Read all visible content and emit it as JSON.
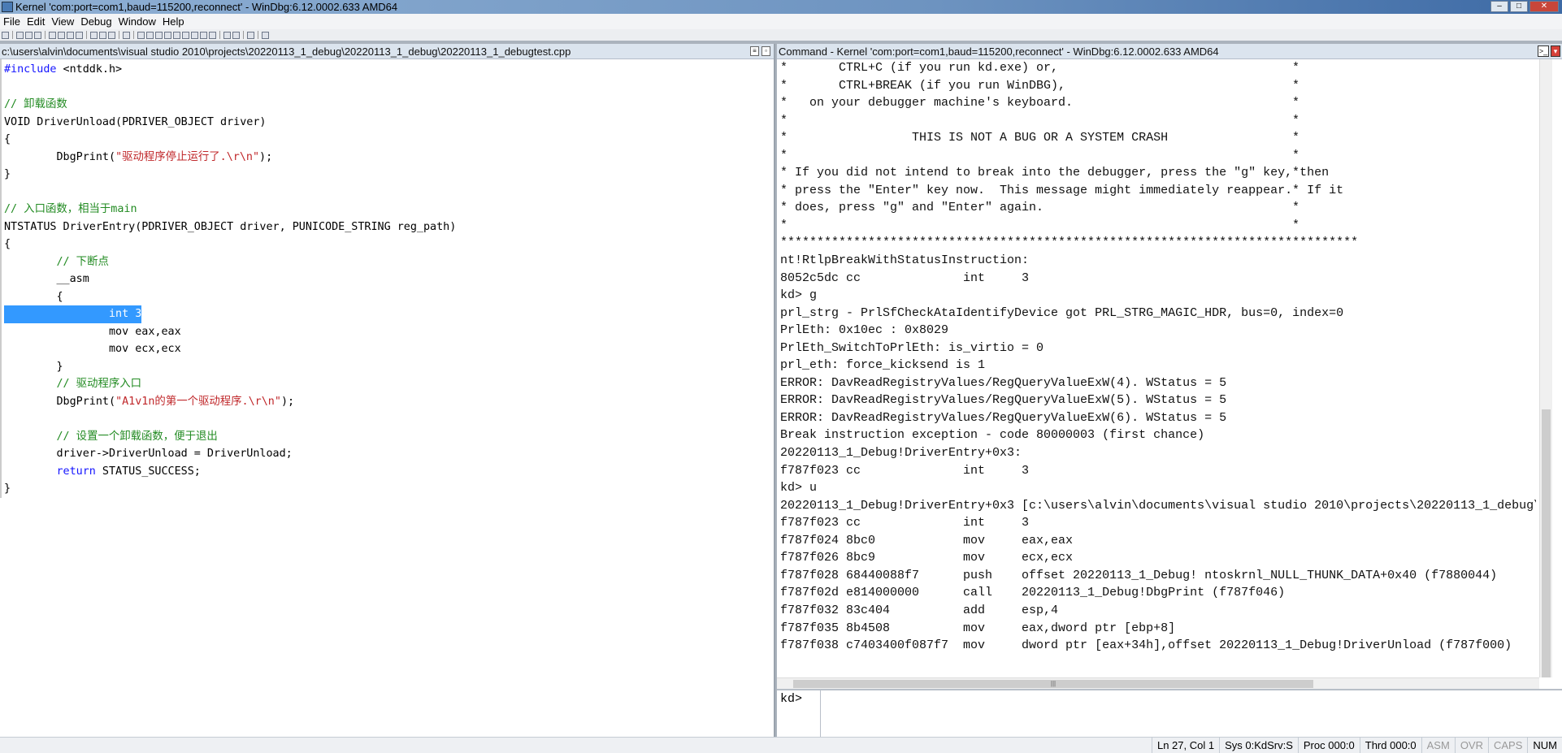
{
  "window": {
    "title": "Kernel 'com:port=com1,baud=115200,reconnect' - WinDbg:6.12.0002.633 AMD64"
  },
  "menu": [
    "File",
    "Edit",
    "View",
    "Debug",
    "Window",
    "Help"
  ],
  "source": {
    "path": "c:\\users\\alvin\\documents\\visual studio 2010\\projects\\20220113_1_debug\\20220113_1_debug\\20220113_1_debugtest.cpp",
    "lines": [
      [
        {
          "c": "kw",
          "t": "#include"
        },
        {
          "t": " <ntddk.h>"
        }
      ],
      [],
      [
        {
          "c": "cm",
          "t": "// 卸载函数"
        }
      ],
      [
        {
          "t": "VOID DriverUnload(PDRIVER_OBJECT driver)"
        }
      ],
      [
        {
          "t": "{"
        }
      ],
      [
        {
          "t": "        DbgPrint("
        },
        {
          "c": "st",
          "t": "\"驱动程序停止运行了.\\r\\n\""
        },
        {
          "t": ");"
        }
      ],
      [
        {
          "t": "}"
        }
      ],
      [],
      [
        {
          "c": "cm",
          "t": "// 入口函数，相当于main"
        }
      ],
      [
        {
          "t": "NTSTATUS DriverEntry(PDRIVER_OBJECT driver, PUNICODE_STRING reg_path)"
        }
      ],
      [
        {
          "t": "{"
        }
      ],
      [
        {
          "t": "        "
        },
        {
          "c": "cm",
          "t": "// 下断点"
        }
      ],
      [
        {
          "t": "        __asm"
        }
      ],
      [
        {
          "t": "        {"
        }
      ],
      [
        {
          "c": "hl",
          "t": "                int 3"
        }
      ],
      [
        {
          "t": "                mov eax,eax"
        }
      ],
      [
        {
          "t": "                mov ecx,ecx"
        }
      ],
      [
        {
          "t": "        }"
        }
      ],
      [
        {
          "t": "        "
        },
        {
          "c": "cm",
          "t": "// 驱动程序入口"
        }
      ],
      [
        {
          "t": "        DbgPrint("
        },
        {
          "c": "st",
          "t": "\"A1v1n的第一个驱动程序.\\r\\n\""
        },
        {
          "t": ");"
        }
      ],
      [],
      [
        {
          "t": "        "
        },
        {
          "c": "cm",
          "t": "// 设置一个卸载函数，便于退出"
        }
      ],
      [
        {
          "t": "        driver->DriverUnload = DriverUnload;"
        }
      ],
      [
        {
          "t": "        "
        },
        {
          "c": "kw",
          "t": "return"
        },
        {
          "t": " STATUS_SUCCESS;"
        }
      ],
      [
        {
          "t": "}"
        }
      ]
    ]
  },
  "command": {
    "title": "Command - Kernel 'com:port=com1,baud=115200,reconnect' - WinDbg:6.12.0002.633 AMD64",
    "prompt": "kd>",
    "input": "",
    "output": [
      {
        "t": "*       CTRL+C (if you run kd.exe) or,",
        "e": "*"
      },
      {
        "t": "*       CTRL+BREAK (if you run WinDBG),",
        "e": "*"
      },
      {
        "t": "*   on your debugger machine's keyboard.",
        "e": "*"
      },
      {
        "t": "*",
        "e": "*"
      },
      {
        "t": "*                 THIS IS NOT A BUG OR A SYSTEM CRASH",
        "e": "*"
      },
      {
        "t": "*",
        "e": "*"
      },
      {
        "t": "* If you did not intend to break into the debugger, press the \"g\" key, then",
        "e": "*"
      },
      {
        "t": "* press the \"Enter\" key now.  This message might immediately reappear.  If it",
        "e": "*"
      },
      {
        "t": "* does, press \"g\" and \"Enter\" again.",
        "e": "*"
      },
      {
        "t": "*",
        "e": "*"
      },
      {
        "t": "*******************************************************************************"
      },
      {
        "t": "nt!RtlpBreakWithStatusInstruction:"
      },
      {
        "t": "8052c5dc cc              int     3"
      },
      {
        "t": "kd> g"
      },
      {
        "t": "prl_strg - PrlSfCheckAtaIdentifyDevice got PRL_STRG_MAGIC_HDR, bus=0, index=0"
      },
      {
        "t": "PrlEth: 0x10ec : 0x8029"
      },
      {
        "t": "PrlEth_SwitchToPrlEth: is_virtio = 0"
      },
      {
        "t": "prl_eth: force_kicksend is 1"
      },
      {
        "t": "ERROR: DavReadRegistryValues/RegQueryValueExW(4). WStatus = 5"
      },
      {
        "t": "ERROR: DavReadRegistryValues/RegQueryValueExW(5). WStatus = 5"
      },
      {
        "t": "ERROR: DavReadRegistryValues/RegQueryValueExW(6). WStatus = 5"
      },
      {
        "t": "Break instruction exception - code 80000003 (first chance)"
      },
      {
        "t": "20220113_1_Debug!DriverEntry+0x3:"
      },
      {
        "t": "f787f023 cc              int     3"
      },
      {
        "t": "kd> u"
      },
      {
        "t": "20220113_1_Debug!DriverEntry+0x3 [c:\\users\\alvin\\documents\\visual studio 2010\\projects\\20220113_1_debug\\20220113_1_d"
      },
      {
        "t": "f787f023 cc              int     3"
      },
      {
        "t": "f787f024 8bc0            mov     eax,eax"
      },
      {
        "t": "f787f026 8bc9            mov     ecx,ecx"
      },
      {
        "t": "f787f028 68440088f7      push    offset 20220113_1_Debug! ntoskrnl_NULL_THUNK_DATA+0x40 (f7880044)"
      },
      {
        "t": "f787f02d e814000000      call    20220113_1_Debug!DbgPrint (f787f046)"
      },
      {
        "t": "f787f032 83c404          add     esp,4"
      },
      {
        "t": "f787f035 8b4508          mov     eax,dword ptr [ebp+8]"
      },
      {
        "t": "f787f038 c7403400f087f7  mov     dword ptr [eax+34h],offset 20220113_1_Debug!DriverUnload (f787f000)"
      }
    ]
  },
  "status": [
    {
      "t": "Ln 27, Col 1",
      "on": true
    },
    {
      "t": "Sys 0:KdSrv:S",
      "on": true
    },
    {
      "t": "Proc 000:0",
      "on": true
    },
    {
      "t": "Thrd 000:0",
      "on": true
    },
    {
      "t": "ASM",
      "on": false
    },
    {
      "t": "OVR",
      "on": false
    },
    {
      "t": "CAPS",
      "on": false
    },
    {
      "t": "NUM",
      "on": true
    }
  ]
}
